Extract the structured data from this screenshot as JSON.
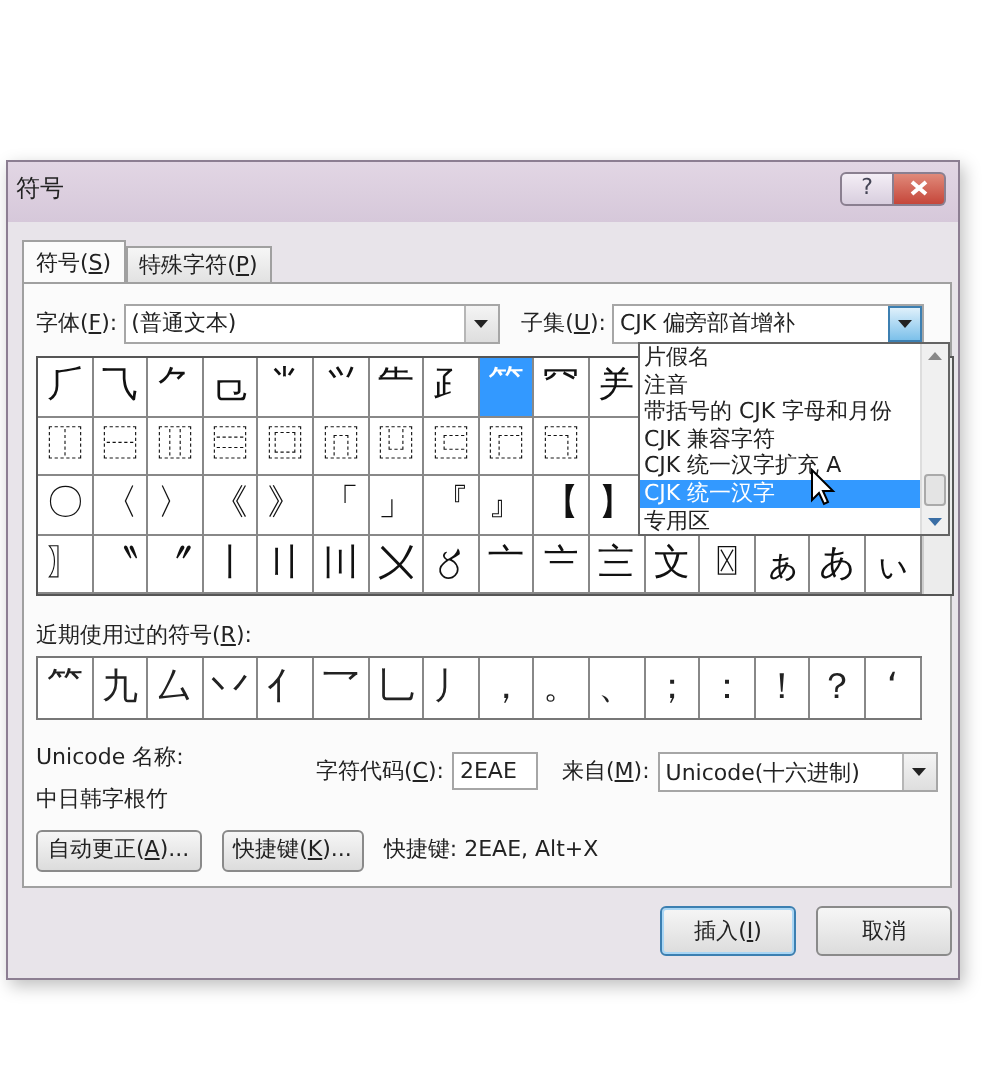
{
  "window": {
    "title": "符号"
  },
  "title_buttons": [
    {
      "kind": "help",
      "label": "?"
    },
    {
      "kind": "close"
    }
  ],
  "tabs": [
    {
      "pre": "符号(",
      "key": "S",
      "post": ")",
      "selected": true
    },
    {
      "pre": "特殊字符(",
      "key": "P",
      "post": ")",
      "selected": false
    }
  ],
  "font": {
    "label": {
      "pre": "字体(",
      "key": "F",
      "post": "):"
    },
    "value": "(普通文本)"
  },
  "subset": {
    "label": {
      "pre": "子集(",
      "key": "U",
      "post": "):"
    },
    "value": "CJK 偏旁部首增补",
    "open": true,
    "options": [
      {
        "text": "片假名",
        "selected": false
      },
      {
        "text": "注音",
        "selected": false
      },
      {
        "text": "带括号的 CJK 字母和月份",
        "selected": false
      },
      {
        "text": "CJK 兼容字符",
        "selected": false
      },
      {
        "text": "CJK 统一汉字扩充 A",
        "selected": false
      },
      {
        "text": "CJK 统一汉字",
        "selected": true
      },
      {
        "text": "专用区",
        "selected": false
      }
    ]
  },
  "symbols": [
    [
      {
        "char": "⺁",
        "selected": false
      },
      {
        "char": "⺄",
        "selected": false
      },
      {
        "char": "⺈",
        "selected": false
      },
      {
        "char": "⺋",
        "selected": false
      },
      {
        "char": "⺌",
        "selected": false
      },
      {
        "char": "⺍",
        "selected": false
      },
      {
        "char": "⺧",
        "selected": false
      },
      {
        "char": "⺪",
        "selected": false
      },
      {
        "char": "⺮",
        "selected": true
      },
      {
        "char": "⺳",
        "selected": false
      },
      {
        "char": "⺶",
        "selected": false
      }
    ],
    [
      {
        "char": "⿰",
        "selected": false
      },
      {
        "char": "⿱",
        "selected": false
      },
      {
        "char": "⿲",
        "selected": false
      },
      {
        "char": "⿳",
        "selected": false
      },
      {
        "char": "⿴",
        "selected": false
      },
      {
        "char": "⿵",
        "selected": false
      },
      {
        "char": "⿶",
        "selected": false
      },
      {
        "char": "⿷",
        "selected": false
      },
      {
        "char": "⿸",
        "selected": false
      },
      {
        "char": "⿹",
        "selected": false
      }
    ],
    [
      {
        "char": "〇",
        "selected": false
      },
      {
        "char": "〈",
        "selected": false
      },
      {
        "char": "〉",
        "selected": false
      },
      {
        "char": "《",
        "selected": false
      },
      {
        "char": "》",
        "selected": false
      },
      {
        "char": "「",
        "selected": false
      },
      {
        "char": "」",
        "selected": false
      },
      {
        "char": "『",
        "selected": false
      },
      {
        "char": "』",
        "selected": false
      },
      {
        "char": "【",
        "selected": false
      },
      {
        "char": "】",
        "selected": false
      }
    ],
    [
      {
        "char": "〗",
        "selected": false
      },
      {
        "char": "〝",
        "selected": false
      },
      {
        "char": "〞",
        "selected": false
      },
      {
        "char": "〡",
        "selected": false
      },
      {
        "char": "〢",
        "selected": false
      },
      {
        "char": "〣",
        "selected": false
      },
      {
        "char": "〤",
        "selected": false
      },
      {
        "char": "〥",
        "selected": false
      },
      {
        "char": "〦",
        "selected": false
      },
      {
        "char": "〧",
        "selected": false
      },
      {
        "char": "〨",
        "selected": false
      },
      {
        "char": "文",
        "selected": false
      },
      {
        "char": "〿",
        "selected": false
      },
      {
        "char": "ぁ",
        "selected": false
      },
      {
        "char": "あ",
        "selected": false
      },
      {
        "char": "ぃ",
        "selected": false
      }
    ]
  ],
  "recent": {
    "label": {
      "pre": "近期使用过的符号(",
      "key": "R",
      "post": "):"
    },
    "chars": [
      "⺮",
      "九",
      "厶",
      "丷",
      "亻",
      "乛",
      "乚",
      "丿",
      "，",
      "。",
      "、",
      "；",
      "：",
      "！",
      "？",
      "‘"
    ]
  },
  "unicode_name": {
    "label": "Unicode 名称:",
    "value": "中日韩字根竹"
  },
  "char_code": {
    "label": {
      "pre": "字符代码(",
      "key": "C",
      "post": "):"
    },
    "value": "2EAE"
  },
  "from": {
    "label": {
      "pre": "来自(",
      "key": "M",
      "post": "):"
    },
    "value": "Unicode(十六进制)"
  },
  "buttons": [
    {
      "pre": "自动更正(",
      "key": "A",
      "post": ")..."
    },
    {
      "pre": "快捷键(",
      "key": "K",
      "post": ")..."
    }
  ],
  "shortcut_text": "快捷键: 2EAE, Alt+X",
  "footer_buttons": [
    {
      "pre": "插入(",
      "key": "I",
      "post": ")",
      "default": true
    },
    {
      "pre": "取消",
      "default": false
    }
  ]
}
